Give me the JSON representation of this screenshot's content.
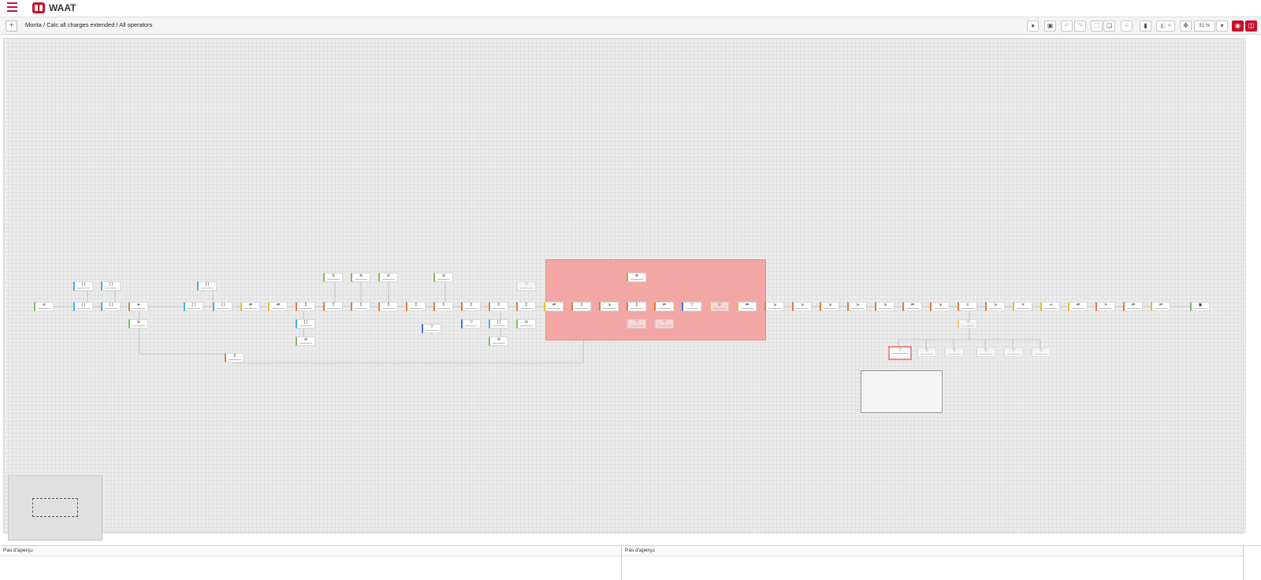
{
  "app": {
    "name": "WAAT"
  },
  "breadcrumb": "Monta / Calc all charges extended / All operators",
  "toolbar": {
    "zoom": "51 %",
    "plus": "+"
  },
  "icons": {
    "menu": "hamburger-menu-icon",
    "logo": "waat-logo-icon",
    "info": "info-icon",
    "save": "save-icon",
    "undo": "undo-icon",
    "redo": "redo-icon",
    "copy": "copy-icon",
    "paste": "paste-icon",
    "comment": "comment-icon",
    "bookmark": "bookmark-icon",
    "fit": "fit-screen-icon",
    "preview": "eye-icon",
    "window": "window-icon"
  },
  "colors": {
    "accent": "#c8102e",
    "highlight_zone": "#f2a7a5"
  },
  "panels": {
    "left": {
      "title": "Pas d'aperçu"
    },
    "right": {
      "title": "Pas d'aperçu"
    }
  }
}
